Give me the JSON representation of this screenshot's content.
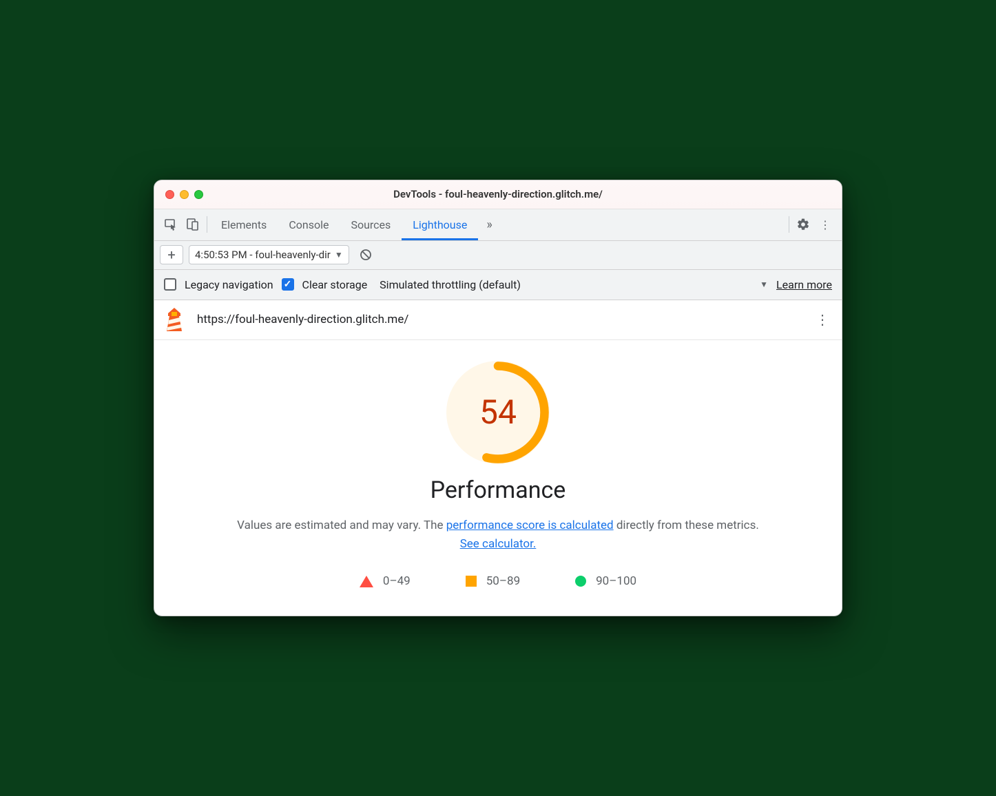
{
  "window": {
    "title": "DevTools - foul-heavenly-direction.glitch.me/"
  },
  "toolbar": {
    "tabs": [
      "Elements",
      "Console",
      "Sources",
      "Lighthouse"
    ],
    "active_tab": "Lighthouse"
  },
  "subtoolbar": {
    "report_label": "4:50:53 PM - foul-heavenly-dir"
  },
  "options": {
    "legacy_label": "Legacy navigation",
    "legacy_checked": false,
    "clear_label": "Clear storage",
    "clear_checked": true,
    "throttling_label": "Simulated throttling (default)",
    "learn_more": "Learn more"
  },
  "urlbar": {
    "url": "https://foul-heavenly-direction.glitch.me/"
  },
  "report": {
    "score": 54,
    "category": "Performance",
    "desc_prefix": "Values are estimated and may vary. The ",
    "link1": "performance score is calculated",
    "desc_mid": " directly from these metrics. ",
    "link2": "See calculator.",
    "legend": {
      "fail": "0–49",
      "avg": "50–89",
      "pass": "90–100"
    }
  },
  "colors": {
    "score_ring": "#fa3",
    "score_text": "#c33300"
  }
}
